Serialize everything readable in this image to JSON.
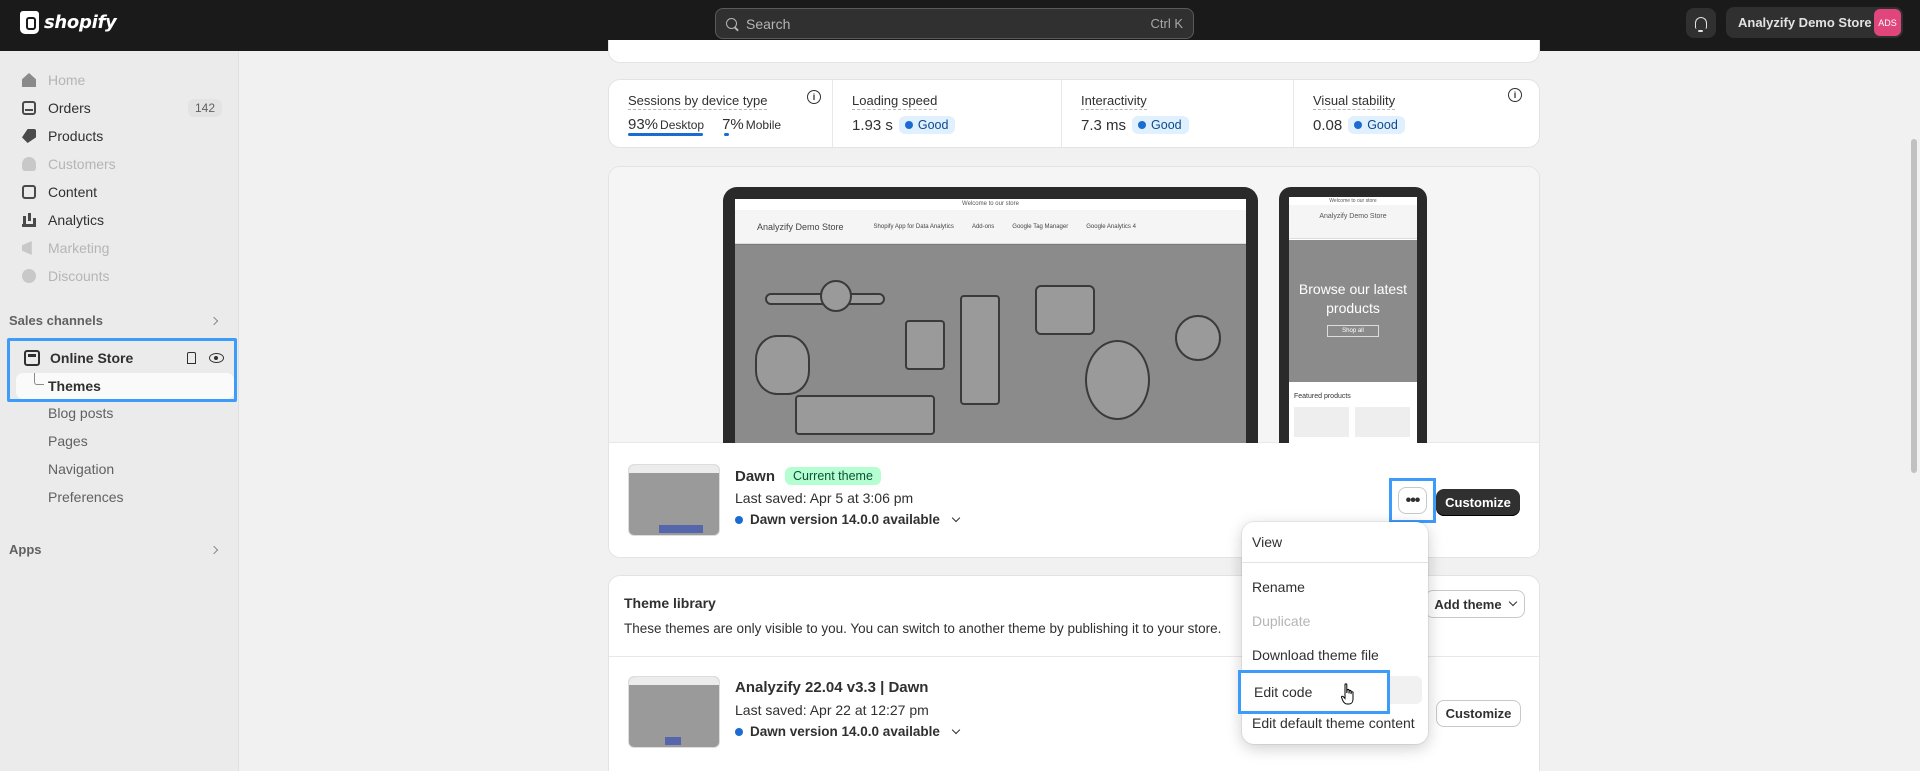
{
  "topbar": {
    "logo_text": "shopify",
    "search_placeholder": "Search",
    "search_shortcut": "Ctrl K",
    "store_name": "Analyzify Demo Store",
    "avatar_initials": "ADS"
  },
  "sidebar": {
    "items": [
      {
        "label": "Home",
        "dim": true
      },
      {
        "label": "Orders",
        "badge": "142"
      },
      {
        "label": "Products"
      },
      {
        "label": "Customers",
        "dim": true
      },
      {
        "label": "Content"
      },
      {
        "label": "Analytics"
      },
      {
        "label": "Marketing",
        "dim": true
      },
      {
        "label": "Discounts",
        "dim": true
      }
    ],
    "sales_channels_label": "Sales channels",
    "online_store_label": "Online Store",
    "themes_label": "Themes",
    "sub_items": [
      "Blog posts",
      "Pages",
      "Navigation",
      "Preferences"
    ],
    "apps_label": "Apps"
  },
  "metrics": {
    "sessions": {
      "label": "Sessions by device type",
      "desktop_pct": "93%",
      "desktop_label": "Desktop",
      "mobile_pct": "7%",
      "mobile_label": "Mobile"
    },
    "loading": {
      "label": "Loading speed",
      "value": "1.93 s",
      "status": "Good"
    },
    "interactivity": {
      "label": "Interactivity",
      "value": "7.3 ms",
      "status": "Good"
    },
    "visual": {
      "label": "Visual stability",
      "value": "0.08",
      "status": "Good"
    }
  },
  "preview": {
    "announcement": "Welcome to our store",
    "brand": "Analyzify Demo Store",
    "nav": [
      "Shopify App for Data Analytics",
      "Add-ons",
      "Google Tag Manager",
      "Google Analytics 4"
    ],
    "phone_announcement": "Welcome to our store",
    "phone_brand": "Analyzify Demo Store",
    "phone_hero": "Browse our latest products",
    "phone_button": "Shop all",
    "phone_featured": "Featured products"
  },
  "current_theme": {
    "name": "Dawn",
    "badge": "Current theme",
    "saved": "Last saved: Apr 5 at 3:06 pm",
    "version": "Dawn version 14.0.0 available",
    "more_label": "•••",
    "customize_label": "Customize"
  },
  "menu": {
    "items": [
      "View",
      "Rename",
      "Duplicate",
      "Download theme file",
      "Edit code",
      "Edit default theme content"
    ]
  },
  "library": {
    "title": "Theme library",
    "description": "These themes are only visible to you. You can switch to another theme by publishing it to your store.",
    "add_theme_label": "Add theme",
    "theme": {
      "name": "Analyzify 22.04 v3.3 | Dawn",
      "saved": "Last saved: Apr 22 at 12:27 pm",
      "version": "Dawn version 14.0.0 available",
      "customize_label": "Customize"
    }
  }
}
